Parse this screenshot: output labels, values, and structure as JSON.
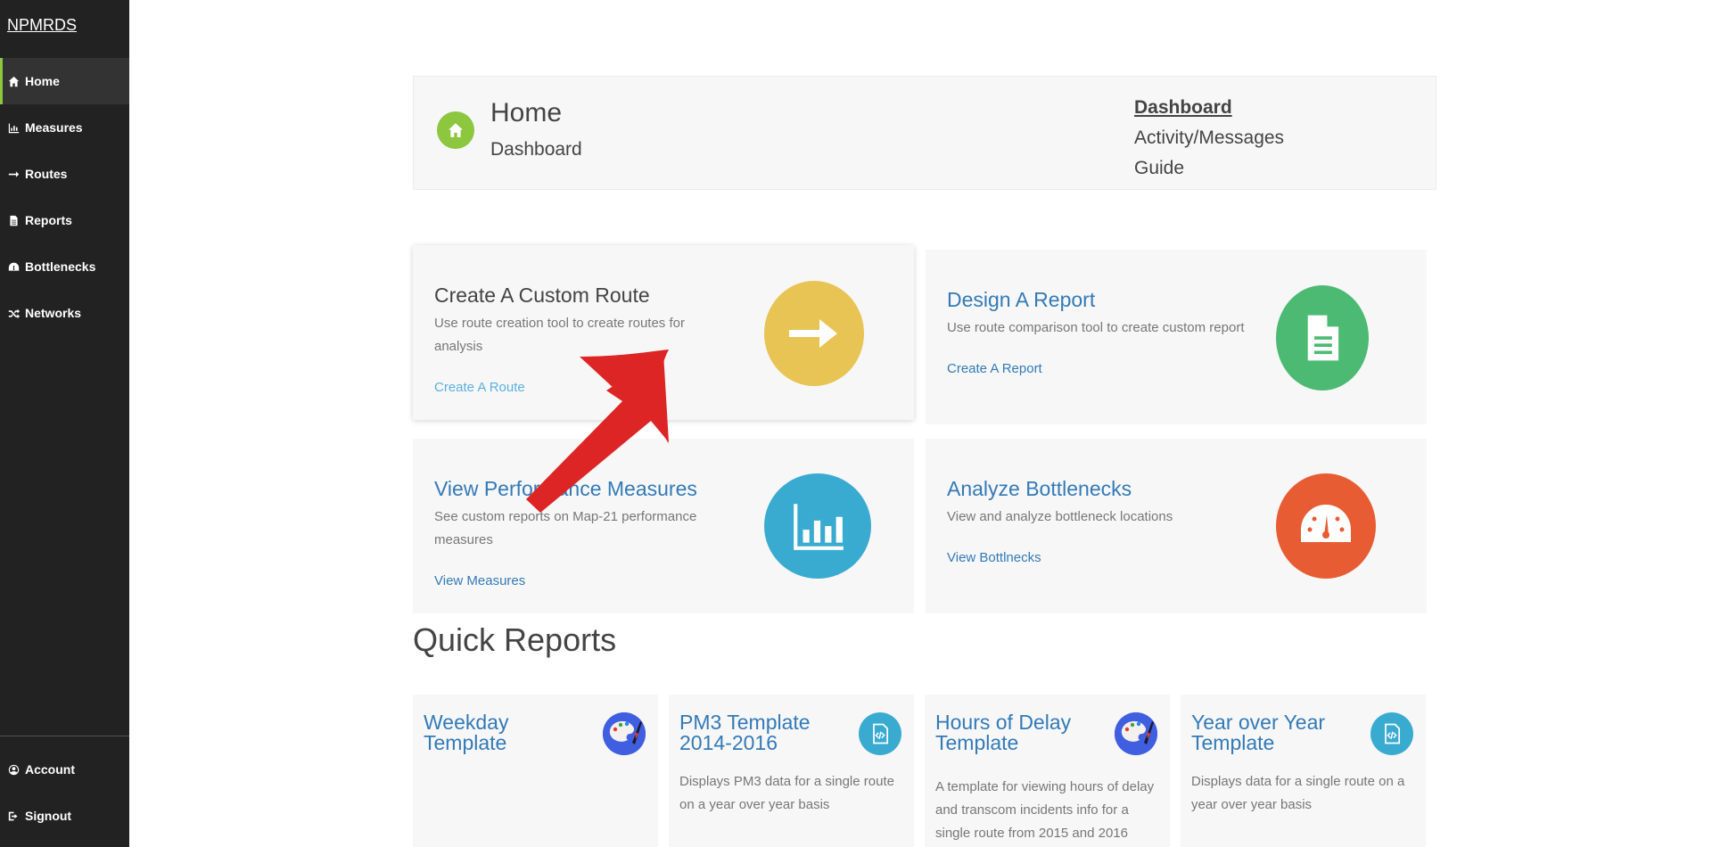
{
  "sidebar": {
    "brand": "NPMRDS",
    "items": [
      {
        "label": "Home",
        "icon": "home-icon"
      },
      {
        "label": "Measures",
        "icon": "bar-chart-icon"
      },
      {
        "label": "Routes",
        "icon": "arrow-right-icon"
      },
      {
        "label": "Reports",
        "icon": "file-icon"
      },
      {
        "label": "Bottlenecks",
        "icon": "dashboard-icon"
      },
      {
        "label": "Networks",
        "icon": "random-icon"
      }
    ],
    "bottom_items": [
      {
        "label": "Account",
        "icon": "user-circle-icon"
      },
      {
        "label": "Signout",
        "icon": "sign-out-icon"
      }
    ]
  },
  "header": {
    "title": "Home",
    "subtitle": "Dashboard",
    "links": [
      "Dashboard",
      "Activity/Messages",
      "Guide"
    ]
  },
  "cards": [
    {
      "title": "Create A Custom Route",
      "desc": "Use route creation tool to create routes for analysis",
      "link": "Create A Route",
      "color": "#e8c454",
      "icon": "arrow-right-icon"
    },
    {
      "title": "Design A Report",
      "desc": "Use route comparison tool to create custom report",
      "link": "Create A Report",
      "color": "#4cba72",
      "icon": "file-text-icon"
    },
    {
      "title": "View Performance Measures",
      "desc": "See custom reports on Map-21 performance measures",
      "link": "View Measures",
      "color": "#3aabd0",
      "icon": "bar-chart-icon"
    },
    {
      "title": "Analyze Bottlenecks",
      "desc": "View and analyze bottleneck locations",
      "link": "View Bottlnecks",
      "color": "#e85c33",
      "icon": "dashboard-icon"
    }
  ],
  "quick_reports": {
    "heading": "Quick Reports",
    "items": [
      {
        "title": "Weekday Template",
        "desc": "",
        "icon": "palette-icon"
      },
      {
        "title": "PM3 Template 2014-2016",
        "desc": "Displays PM3 data for a single route on a year over year basis",
        "icon": "code-file-icon"
      },
      {
        "title": "Hours of Delay Template",
        "desc": "A template for viewing hours of delay and transcom incidents info for a single route from 2015 and 2016",
        "icon": "palette-icon"
      },
      {
        "title": "Year over Year Template",
        "desc": "Displays data for a single route on a year over year basis",
        "icon": "code-file-icon"
      }
    ]
  },
  "colors": {
    "accent_green": "#8dc63f",
    "link_blue": "#337ab7",
    "annotation_red": "#dd2525"
  }
}
